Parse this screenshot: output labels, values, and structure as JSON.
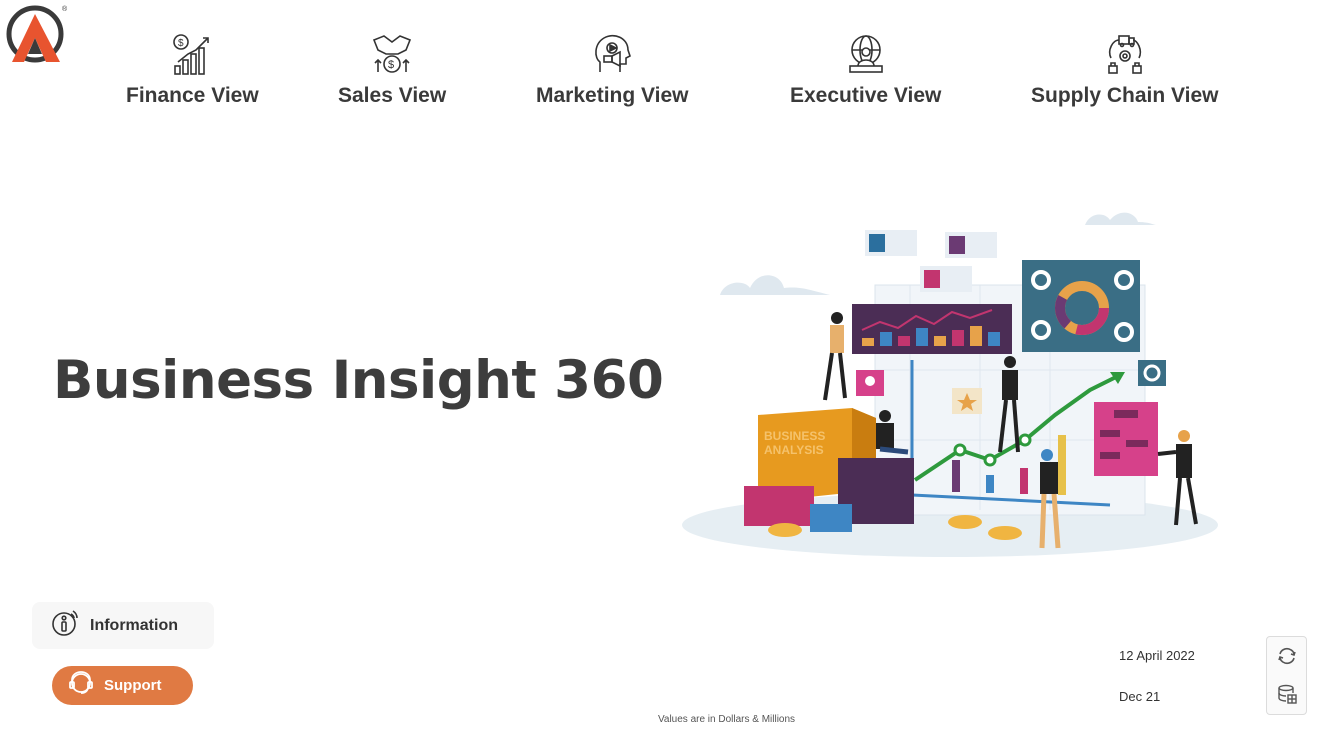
{
  "brand": {
    "logo_accent": "#e8542f"
  },
  "nav": [
    {
      "label": "Finance View",
      "icon": "finance-chart-icon"
    },
    {
      "label": "Sales View",
      "icon": "handshake-money-icon"
    },
    {
      "label": "Marketing View",
      "icon": "marketing-head-icon"
    },
    {
      "label": "Executive View",
      "icon": "executive-globe-icon"
    },
    {
      "label": "Supply Chain View",
      "icon": "supply-chain-icon"
    }
  ],
  "main": {
    "title": "Business Insight 360",
    "hero": {
      "box_text_1": "BUSINESS",
      "box_text_2": "ANALYSIS"
    }
  },
  "buttons": {
    "information": "Information",
    "support": "Support",
    "support_color": "#e07a43"
  },
  "status": {
    "date": "12 April 2022",
    "period": "Dec 21",
    "footnote": "Values are in Dollars & Millions"
  },
  "side_actions": {
    "refresh_icon": "refresh-icon",
    "data_icon": "database-icon"
  }
}
